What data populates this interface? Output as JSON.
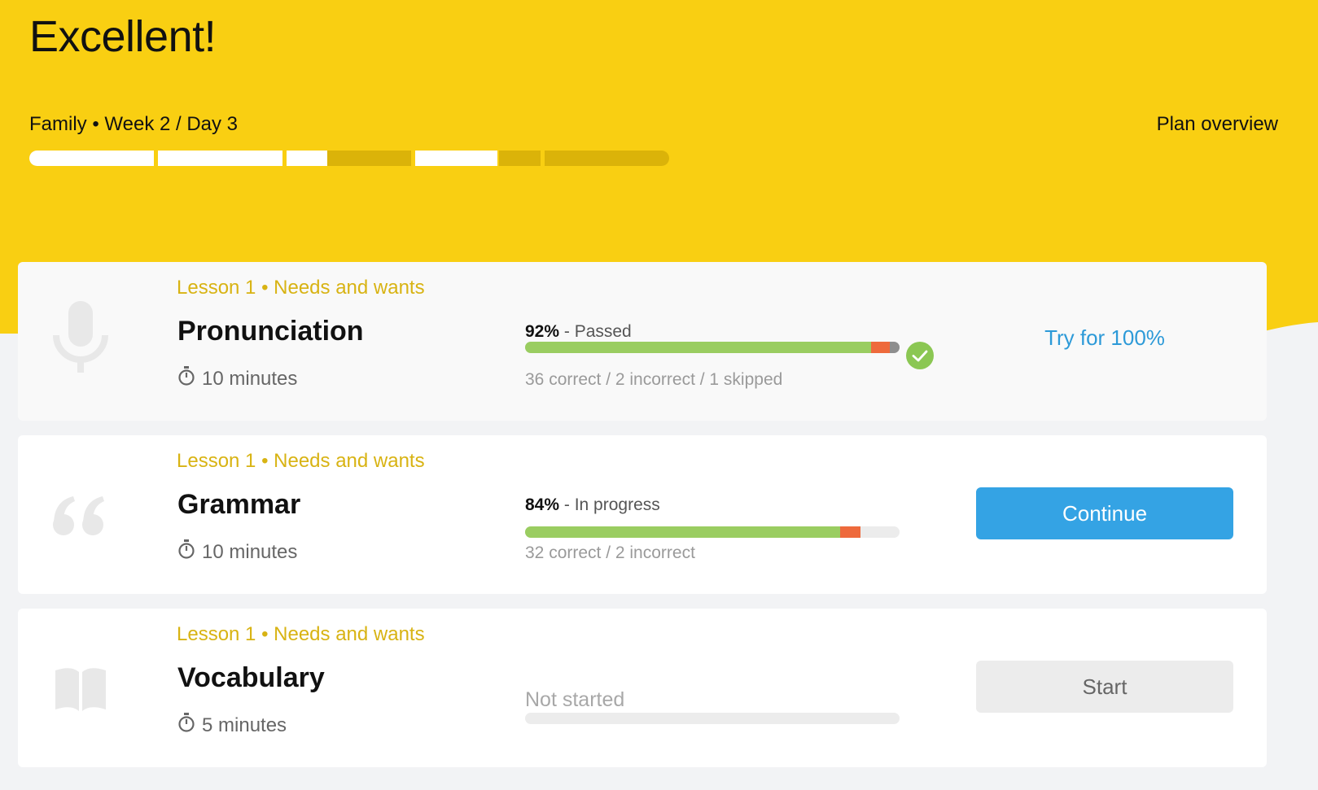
{
  "header": {
    "title": "Excellent!",
    "breadcrumb": "Family • Week 2 / Day 3",
    "plan_overview": "Plan overview",
    "theme_color": "#f9cf12"
  },
  "plan_progress": {
    "segments": [
      1,
      1,
      0.33,
      0,
      1,
      0,
      0
    ]
  },
  "activities": [
    {
      "lesson": "Lesson 1 • Needs and wants",
      "title": "Pronunciation",
      "icon": "microphone-icon",
      "duration": "10 minutes",
      "score": "92%",
      "status": " - Passed",
      "stats": "36 correct / 2 incorrect / 1 skipped",
      "correct": 36,
      "incorrect": 2,
      "skipped": 1,
      "total": 39,
      "completed": true,
      "action": "Try for 100%"
    },
    {
      "lesson": "Lesson 1 • Needs and wants",
      "title": "Grammar",
      "icon": "quote-icon",
      "duration": "10 minutes",
      "score": "84%",
      "status": " - In progress",
      "stats": "32 correct / 2 incorrect",
      "correct": 32,
      "incorrect": 2,
      "skipped": 0,
      "total": 38,
      "completed": false,
      "action": "Continue"
    },
    {
      "lesson": "Lesson 1 • Needs and wants",
      "title": "Vocabulary",
      "icon": "book-icon",
      "duration": "5 minutes",
      "status": "Not started",
      "correct": 0,
      "incorrect": 0,
      "skipped": 0,
      "total": 1,
      "completed": false,
      "action": "Start"
    }
  ],
  "colors": {
    "accent_blue": "#34a3e4",
    "link_blue": "#2d9ad8",
    "correct_green": "#9acd61",
    "incorrect_orange": "#ee6a3c",
    "skipped_gray": "#8e8e8e",
    "lesson_gold": "#d8b313",
    "check_green": "#8bc753"
  }
}
